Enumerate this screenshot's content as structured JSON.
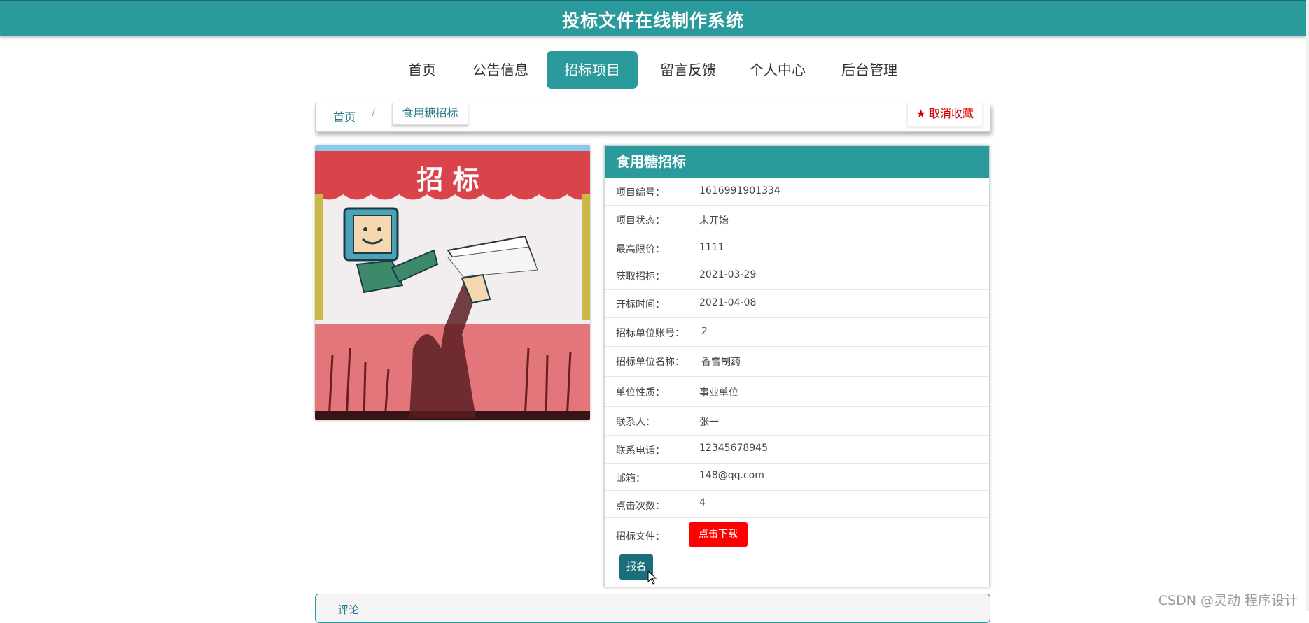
{
  "header": {
    "title": "投标文件在线制作系统"
  },
  "nav": {
    "items": [
      {
        "label": "首页"
      },
      {
        "label": "公告信息"
      },
      {
        "label": "招标项目"
      },
      {
        "label": "留言反馈"
      },
      {
        "label": "个人中心"
      },
      {
        "label": "后台管理"
      }
    ],
    "active": "招标项目"
  },
  "breadcrumb": {
    "home": "首页",
    "separator": "/",
    "current": "食用糖招标"
  },
  "favorite": {
    "label": "取消收藏",
    "icon": "star-icon"
  },
  "image": {
    "banner_text": "招 标"
  },
  "detail": {
    "title": "食用糖招标",
    "rows": [
      {
        "label": "项目编号：",
        "value": "1616991901334"
      },
      {
        "label": "项目状态：",
        "value": "未开始"
      },
      {
        "label": "最高限价：",
        "value": "1111"
      },
      {
        "label": "获取招标：",
        "value": "2021-03-29"
      },
      {
        "label": "开标时间：",
        "value": "2021-04-08"
      },
      {
        "label": "招标单位账号：",
        "value": "2"
      },
      {
        "label": "招标单位名称：",
        "value": "香雪制药"
      },
      {
        "label": "单位性质：",
        "value": "事业单位"
      },
      {
        "label": "联系人：",
        "value": "张一"
      },
      {
        "label": "联系电话：",
        "value": "12345678945"
      },
      {
        "label": "邮箱：",
        "value": "148@qq.com"
      },
      {
        "label": "点击次数：",
        "value": "4"
      }
    ],
    "file_label": "招标文件：",
    "download_label": "点击下载",
    "signup_label": "报名"
  },
  "comments": {
    "title": "评论"
  },
  "watermark": "CSDN @灵动 程序设计",
  "colors": {
    "primary": "#2a9a9c",
    "danger": "#ff0000",
    "dark_button": "#1b6f7a"
  }
}
